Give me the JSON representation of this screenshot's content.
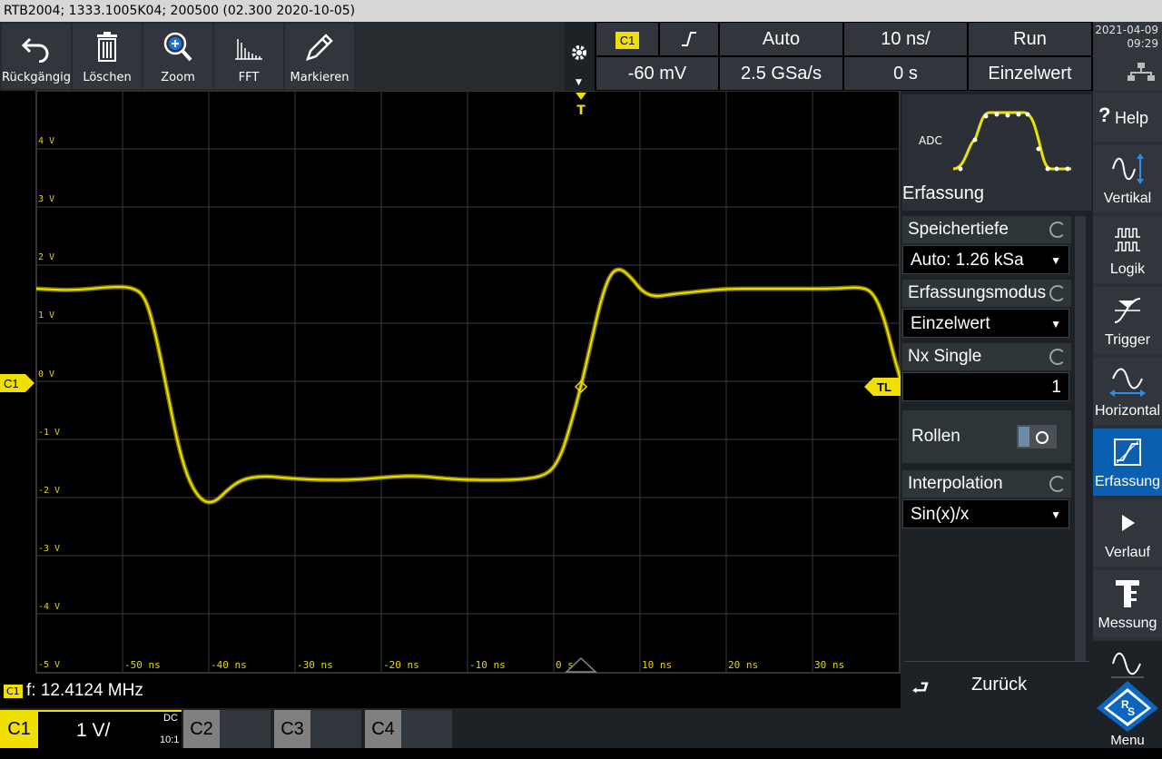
{
  "title_bar": "RTB2004; 1333.1005K04; 200500 (02.300 2020-10-05)",
  "toolbar": [
    {
      "label": "Rückgängig",
      "icon": "undo-icon"
    },
    {
      "label": "Löschen",
      "icon": "trash-icon"
    },
    {
      "label": "Zoom",
      "icon": "zoom-icon"
    },
    {
      "label": "FFT",
      "icon": "fft-icon"
    },
    {
      "label": "Markieren",
      "icon": "pen-icon"
    }
  ],
  "status": {
    "channel_badge": "C1",
    "trigger_slope": "∰",
    "trigger_mode": "Auto",
    "timebase": "10 ns/",
    "run_state": "Run",
    "trigger_level": "-60 mV",
    "sample_rate": "2.5 GSa/s",
    "trigger_offset": "0 s",
    "acq_mode": "Einzelwert",
    "date": "2021-04-09",
    "time": "09:29"
  },
  "scope": {
    "y_labels": [
      "4 V",
      "3 V",
      "2 V",
      "1 V",
      "0 V",
      "-1 V",
      "-2 V",
      "-3 V",
      "-4 V",
      "-5 V"
    ],
    "x_labels": [
      "-50 ns",
      "-40 ns",
      "-30 ns",
      "-20 ns",
      "-10 ns",
      "0 s",
      "10 ns",
      "20 ns",
      "30 ns"
    ],
    "ch_marker": "C1",
    "trigger_level_marker": "TL",
    "trigger_marker": "T",
    "trace_color": "#f0e000"
  },
  "panel": {
    "adc_label": "ADC",
    "title": "Erfassung",
    "rows": [
      {
        "label": "Speichertiefe",
        "value": "Auto: 1.26 kSa",
        "type": "select"
      },
      {
        "label": "Erfassungsmodus",
        "value": "Einzelwert",
        "type": "select"
      },
      {
        "label": "Nx Single",
        "value": "1",
        "type": "number"
      }
    ],
    "rollen_label": "Rollen",
    "interp_label": "Interpolation",
    "interp_value": "Sin(x)/x",
    "back_label": "Zurück"
  },
  "sidebar": [
    {
      "label": "Help",
      "icon": "help-icon"
    },
    {
      "label": "Vertikal",
      "icon": "vertical-icon"
    },
    {
      "label": "Logik",
      "icon": "logic-icon"
    },
    {
      "label": "Trigger",
      "icon": "trigger-icon"
    },
    {
      "label": "Horizontal",
      "icon": "horizontal-icon"
    },
    {
      "label": "Erfassung",
      "icon": "acquisition-icon"
    },
    {
      "label": "Verlauf",
      "icon": "play-icon"
    },
    {
      "label": "Messung",
      "icon": "measure-icon"
    },
    {
      "label": "Menu",
      "icon": "menu-icon"
    }
  ],
  "bottom": {
    "freq_badge": "C1",
    "freq_text": "f: 12.4124 MHz",
    "c1_label": "C1",
    "c1_scale": "1 V/",
    "c1_coupling": "DC",
    "c1_ratio": "10:1",
    "c2_label": "C2",
    "c3_label": "C3",
    "c4_label": "C4"
  }
}
